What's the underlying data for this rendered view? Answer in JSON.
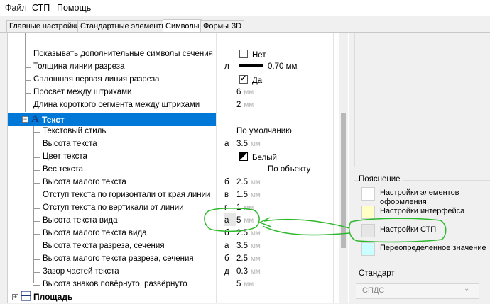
{
  "menu": [
    "Файл",
    "СТП",
    "Помощь"
  ],
  "tabs": [
    "Главные настройки",
    "Стандартные элементы",
    "Символы",
    "Формы",
    "3D"
  ],
  "active_tab": 2,
  "properties": [
    {
      "name": "Показывать дополнительные символы сечения",
      "prefix": "",
      "value": "Нет",
      "unit": "",
      "control": "checkbox",
      "checked": false
    },
    {
      "name": "Толщина линии разреза",
      "prefix": "л",
      "value": "0.70 мм",
      "unit": "",
      "control": "thick-line"
    },
    {
      "name": "Сплошная первая линия разреза",
      "prefix": "",
      "value": "Да",
      "unit": "",
      "control": "checkbox",
      "checked": true
    },
    {
      "name": "Просвет между штрихами",
      "prefix": "",
      "value": "6",
      "unit": "мм"
    },
    {
      "name": "Длина короткого сегмента между штрихами",
      "prefix": "",
      "value": "2",
      "unit": "мм"
    }
  ],
  "section": {
    "title": "Текст",
    "icon": "text-style-icon"
  },
  "text_properties": [
    {
      "name": "Текстовый стиль",
      "prefix": "",
      "value": "По умолчанию",
      "unit": ""
    },
    {
      "name": "Высота текста",
      "prefix": "а",
      "value": "3.5",
      "unit": "мм"
    },
    {
      "name": "Цвет текста",
      "prefix": "",
      "value": "Белый",
      "unit": "",
      "control": "color"
    },
    {
      "name": "Вес текста",
      "prefix": "",
      "value": "По объекту",
      "unit": "",
      "control": "thin-line"
    },
    {
      "name": "Высота малого текста",
      "prefix": "б",
      "value": "2.5",
      "unit": "мм"
    },
    {
      "name": "Отступ текста по горизонтали от края линии",
      "prefix": "в",
      "value": "1.5",
      "unit": "мм"
    },
    {
      "name": "Отступ текста по вертикали от линии",
      "prefix": "г",
      "value": "1",
      "unit": "мм"
    },
    {
      "name": "Высота текста вида",
      "prefix": "а",
      "value": "5",
      "unit": "мм",
      "highlighted": true
    },
    {
      "name": "Высота малого текста вида",
      "prefix": "б",
      "value": "2.5",
      "unit": "мм"
    },
    {
      "name": "Высота текста разреза, сечения",
      "prefix": "а",
      "value": "3.5",
      "unit": "мм"
    },
    {
      "name": "Высота малого текста разреза, сечения",
      "prefix": "б",
      "value": "2.5",
      "unit": "мм"
    },
    {
      "name": "Зазор частей текста",
      "prefix": "д",
      "value": "0.3",
      "unit": "мм"
    },
    {
      "name": "Высота знаков повёрнуто, развёрнуто",
      "prefix": "",
      "value": "5",
      "unit": "мм"
    }
  ],
  "next_section": {
    "title": "Площадь",
    "icon": "area-icon"
  },
  "legend": {
    "title": "Пояснение",
    "items": [
      {
        "label": "Настройки элементов оформления",
        "color": "#ffffff"
      },
      {
        "label": "Настройки интерфейса",
        "color": "#ffffc6"
      },
      {
        "label": "Настройки СТП",
        "color": "#e6e6e6"
      },
      {
        "label": "Переопределенное значение",
        "color": "#ccffff"
      }
    ]
  },
  "standard": {
    "title": "Стандарт",
    "selected": "СПДС"
  },
  "annotation_color": "#2eb82e"
}
